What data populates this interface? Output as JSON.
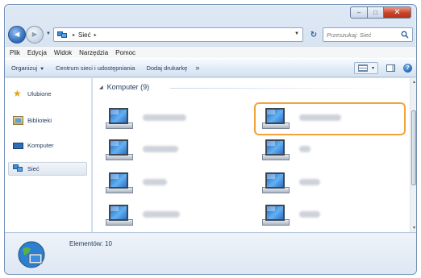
{
  "titlebar": {
    "minimize_glyph": "–",
    "maximize_glyph": "□",
    "close_glyph": "✕"
  },
  "navigation": {
    "back_glyph": "◄",
    "forward_glyph": "►",
    "dropdown_glyph": "▼"
  },
  "address": {
    "crumb_separator": "▸",
    "crumb": "Sieć",
    "dropdown_glyph": "▼",
    "refresh_glyph": "↻"
  },
  "search": {
    "placeholder": "Przeszukaj: Sieć"
  },
  "menubar": {
    "items": [
      "Plik",
      "Edycja",
      "Widok",
      "Narzędzia",
      "Pomoc"
    ]
  },
  "commandbar": {
    "organize_label": "Organizuj",
    "organize_dropdown": "▼",
    "network_center_label": "Centrum sieci i udostępniania",
    "add_printer_label": "Dodaj drukarkę",
    "more_glyph": "»",
    "help_glyph": "?"
  },
  "sidebar": {
    "items": [
      {
        "label": "Ulubione",
        "icon": "star-icon"
      },
      {
        "label": "Biblioteki",
        "icon": "library-icon"
      },
      {
        "label": "Komputer",
        "icon": "computer-icon"
      },
      {
        "label": "Sieć",
        "icon": "network-icon"
      }
    ]
  },
  "content": {
    "group_toggle": "◢",
    "group_title": "Komputer (9)",
    "computers": [
      {
        "icon": "network-computer-icon",
        "name_obscured": true
      },
      {
        "icon": "network-computer-icon",
        "name_obscured": true,
        "highlighted": true
      },
      {
        "icon": "network-computer-icon",
        "name_obscured": true
      },
      {
        "icon": "network-computer-icon",
        "name_obscured": true
      },
      {
        "icon": "network-computer-icon",
        "name_obscured": true
      },
      {
        "icon": "network-computer-icon",
        "name_obscured": true
      },
      {
        "icon": "network-computer-icon",
        "name_obscured": true
      },
      {
        "icon": "network-computer-icon",
        "name_obscured": true
      }
    ],
    "highlight_color": "#f2a33a"
  },
  "scrollbar": {
    "up_glyph": "▲",
    "down_glyph": "▼"
  },
  "details": {
    "status": "Elementów: 10"
  },
  "colors": {
    "frame": "#c4d5ea",
    "text": "#1e395b",
    "close_button": "#c8432a"
  }
}
